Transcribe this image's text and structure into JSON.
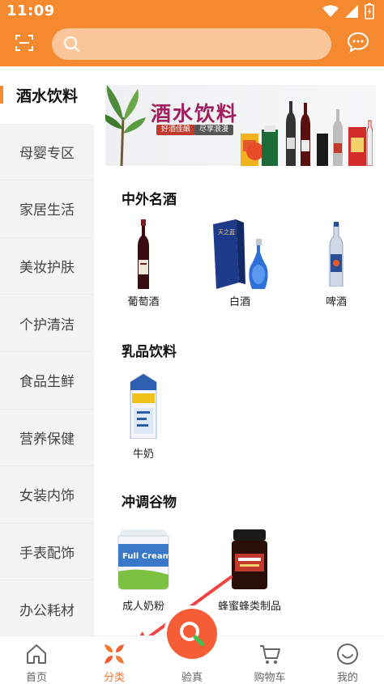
{
  "status_bar": {
    "time": "11:09"
  },
  "header": {
    "search_placeholder": ""
  },
  "categories": [
    {
      "label": "酒水饮料",
      "active": true
    },
    {
      "label": "母婴专区"
    },
    {
      "label": "家居生活"
    },
    {
      "label": "美妆护肤"
    },
    {
      "label": "个护清洁"
    },
    {
      "label": "食品生鲜"
    },
    {
      "label": "营养保健"
    },
    {
      "label": "女装内饰"
    },
    {
      "label": "手表配饰"
    },
    {
      "label": "办公耗材"
    }
  ],
  "banner": {
    "title": "酒水饮料",
    "tag1": "好酒佳酿",
    "tag2": "尽享浪漫"
  },
  "sections": [
    {
      "title": "中外名酒",
      "items": [
        "葡萄酒",
        "白酒",
        "啤酒"
      ]
    },
    {
      "title": "乳品饮料",
      "items": [
        "牛奶"
      ]
    },
    {
      "title": "冲调谷物",
      "items": [
        "成人奶粉",
        "蜂蜜蜂类制品"
      ]
    }
  ],
  "bottom_nav": [
    {
      "label": "首页",
      "icon": "home-icon"
    },
    {
      "label": "分类",
      "icon": "category-icon",
      "active": true
    },
    {
      "label": "验真",
      "icon": "search-magnifier-icon"
    },
    {
      "label": "购物车",
      "icon": "cart-icon"
    },
    {
      "label": "我的",
      "icon": "smile-icon"
    }
  ],
  "colors": {
    "accent": "#f5892f",
    "search_bg": "#fbc79a",
    "center_button": "#f45d36"
  }
}
